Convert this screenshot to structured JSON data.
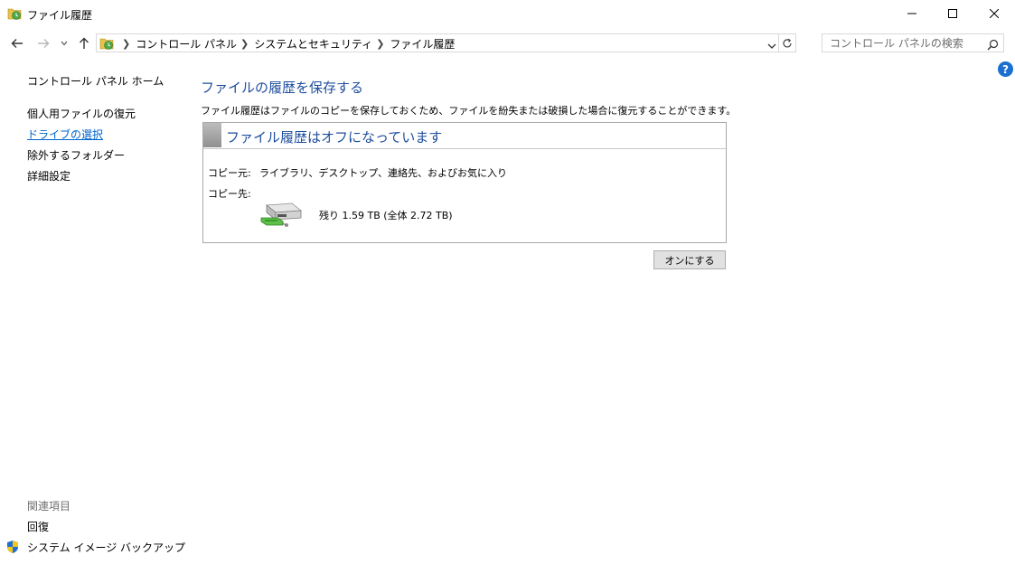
{
  "window": {
    "title": "ファイル履歴"
  },
  "address": {
    "crumbs": [
      "コントロール パネル",
      "システムとセキュリティ",
      "ファイル履歴"
    ]
  },
  "search": {
    "placeholder": "コントロール パネルの検索"
  },
  "sidebar": {
    "home": "コントロール パネル ホーム",
    "items": [
      {
        "label": "個人用ファイルの復元",
        "style": "plain"
      },
      {
        "label": "ドライブの選択",
        "style": "link"
      },
      {
        "label": "除外するフォルダー",
        "style": "plain"
      },
      {
        "label": "詳細設定",
        "style": "plain"
      }
    ],
    "related_header": "関連項目",
    "related": [
      {
        "label": "回復"
      },
      {
        "label": "システム イメージ バックアップ",
        "icon": "shield-icon"
      }
    ]
  },
  "main": {
    "title": "ファイルの履歴を保存する",
    "description": "ファイル履歴はファイルのコピーを保存しておくため、ファイルを紛失または破損した場合に復元することができます。",
    "status": "ファイル履歴はオフになっています",
    "copy_from_label": "コピー元:",
    "copy_from_value": "ライブラリ、デスクトップ、連絡先、およびお気に入り",
    "copy_to_label": "コピー先:",
    "drive_space": "残り 1.59 TB (全体 2.72 TB)",
    "turn_on_button": "オンにする"
  },
  "colors": {
    "heading": "#1e4e9c",
    "link": "#0066cc",
    "help": "#1a6fd0"
  }
}
